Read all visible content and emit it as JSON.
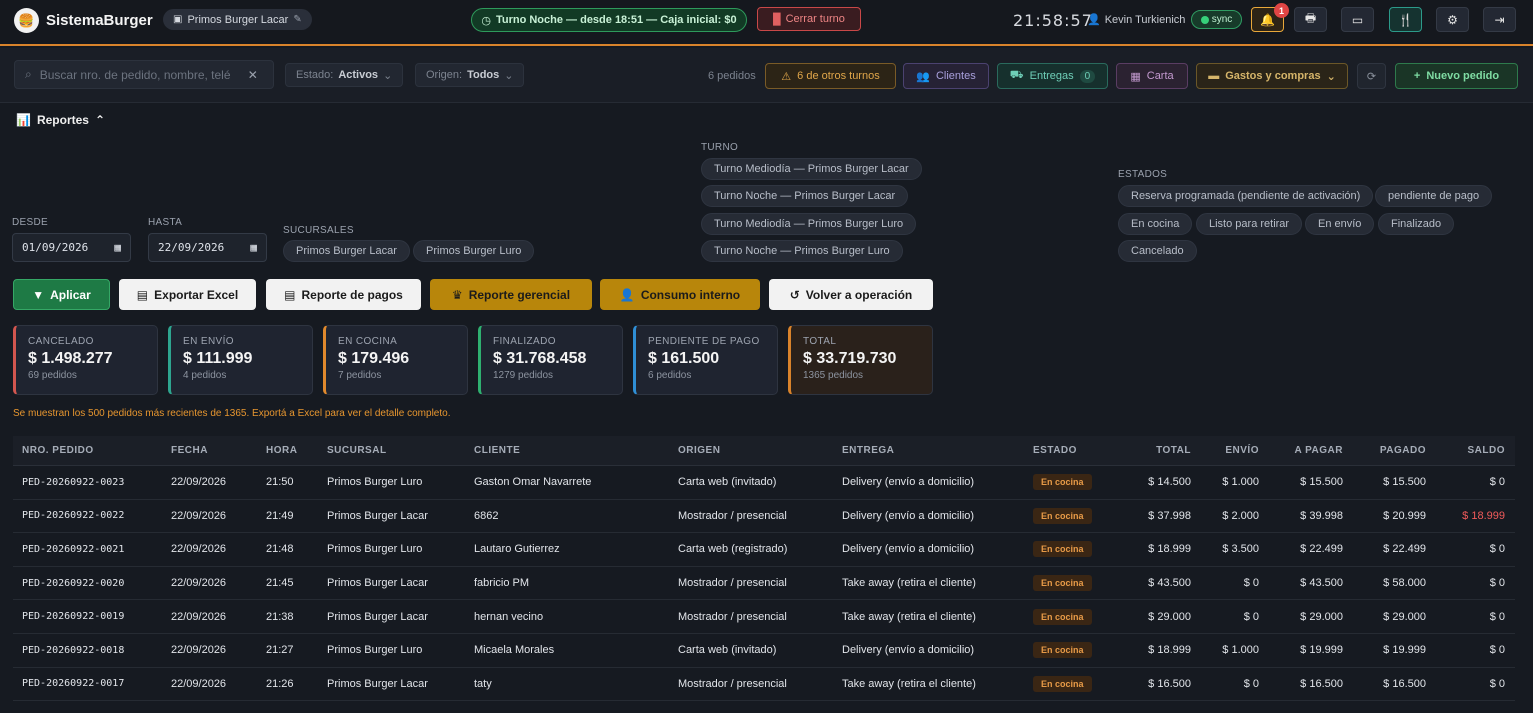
{
  "header": {
    "brand": "SistemaBurger",
    "branch": "Primos Burger Lacar",
    "shift": "Turno Noche — desde 18:51 — Caja inicial: $0",
    "close_shift": "Cerrar turno",
    "clock": "21:58:57",
    "user": "Kevin Turkienich",
    "sync": "sync",
    "notif_count": "1"
  },
  "filters": {
    "search_placeholder": "Buscar nro. de pedido, nombre, telé",
    "estado_label": "Estado:",
    "estado_value": "Activos",
    "origen_label": "Origen:",
    "origen_value": "Todos",
    "count": "6 pedidos",
    "otros_turnos": "6 de otros turnos",
    "clientes": "Clientes",
    "entregas": "Entregas",
    "entregas_count": "0",
    "carta": "Carta",
    "gastos": "Gastos y compras",
    "nuevo": "Nuevo pedido"
  },
  "reports": {
    "title": "Reportes",
    "desde_label": "DESDE",
    "desde": "01/09/2026",
    "hasta_label": "HASTA",
    "hasta": "22/09/2026",
    "sucursales_label": "SUCURSALES",
    "sucursales": [
      "Primos Burger Lacar",
      "Primos Burger Luro"
    ],
    "turno_label": "TURNO",
    "turnos": [
      "Turno Mediodía — Primos Burger Lacar",
      "Turno Noche — Primos Burger Lacar",
      "Turno Mediodía — Primos Burger Luro",
      "Turno Noche — Primos Burger Luro"
    ],
    "estados_label": "ESTADOS",
    "estados": [
      "Reserva programada (pendiente de activación)",
      "pendiente de pago",
      "En cocina",
      "Listo para retirar",
      "En envío",
      "Finalizado",
      "Cancelado"
    ],
    "buttons": {
      "aplicar": "Aplicar",
      "excel": "Exportar Excel",
      "pagos": "Reporte de pagos",
      "gerencial": "Reporte gerencial",
      "consumo": "Consumo interno",
      "volver": "Volver a operación"
    },
    "cards": [
      {
        "k": "CANCELADO",
        "v": "$ 1.498.277",
        "n": "69 pedidos",
        "color": "#d2564f"
      },
      {
        "k": "EN ENVÍO",
        "v": "$ 111.999",
        "n": "4 pedidos",
        "color": "#2ea58f"
      },
      {
        "k": "EN COCINA",
        "v": "$ 179.496",
        "n": "7 pedidos",
        "color": "#e0892d"
      },
      {
        "k": "FINALIZADO",
        "v": "$ 31.768.458",
        "n": "1279 pedidos",
        "color": "#2fb070"
      },
      {
        "k": "PENDIENTE DE PAGO",
        "v": "$ 161.500",
        "n": "6 pedidos",
        "color": "#2f8fd6"
      },
      {
        "k": "TOTAL",
        "v": "$ 33.719.730",
        "n": "1365 pedidos",
        "color": "#d9832b"
      }
    ],
    "notice": "Se muestran los 500 pedidos más recientes de 1365. Exportá a Excel para ver el detalle completo."
  },
  "table": {
    "headers": [
      "NRO. PEDIDO",
      "FECHA",
      "HORA",
      "SUCURSAL",
      "CLIENTE",
      "ORIGEN",
      "ENTREGA",
      "ESTADO",
      "TOTAL",
      "ENVÍO",
      "A PAGAR",
      "PAGADO",
      "SALDO"
    ],
    "rows": [
      [
        "PED-20260922-0023",
        "22/09/2026",
        "21:50",
        "Primos Burger Luro",
        "Gaston Omar Navarrete",
        "Carta web (invitado)",
        "Delivery (envío a domicilio)",
        "En cocina",
        "$ 14.500",
        "$ 1.000",
        "$ 15.500",
        "$ 15.500",
        "$ 0"
      ],
      [
        "PED-20260922-0022",
        "22/09/2026",
        "21:49",
        "Primos Burger Lacar",
        "6862",
        "Mostrador / presencial",
        "Delivery (envío a domicilio)",
        "En cocina",
        "$ 37.998",
        "$ 2.000",
        "$ 39.998",
        "$ 20.999",
        "$ 18.999"
      ],
      [
        "PED-20260922-0021",
        "22/09/2026",
        "21:48",
        "Primos Burger Luro",
        "Lautaro Gutierrez",
        "Carta web (registrado)",
        "Delivery (envío a domicilio)",
        "En cocina",
        "$ 18.999",
        "$ 3.500",
        "$ 22.499",
        "$ 22.499",
        "$ 0"
      ],
      [
        "PED-20260922-0020",
        "22/09/2026",
        "21:45",
        "Primos Burger Lacar",
        "fabricio PM",
        "Mostrador / presencial",
        "Take away (retira el cliente)",
        "En cocina",
        "$ 43.500",
        "$ 0",
        "$ 43.500",
        "$ 58.000",
        "$ 0"
      ],
      [
        "PED-20260922-0019",
        "22/09/2026",
        "21:38",
        "Primos Burger Lacar",
        "hernan vecino",
        "Mostrador / presencial",
        "Take away (retira el cliente)",
        "En cocina",
        "$ 29.000",
        "$ 0",
        "$ 29.000",
        "$ 29.000",
        "$ 0"
      ],
      [
        "PED-20260922-0018",
        "22/09/2026",
        "21:27",
        "Primos Burger Luro",
        "Micaela Morales",
        "Carta web (invitado)",
        "Delivery (envío a domicilio)",
        "En cocina",
        "$ 18.999",
        "$ 1.000",
        "$ 19.999",
        "$ 19.999",
        "$ 0"
      ],
      [
        "PED-20260922-0017",
        "22/09/2026",
        "21:26",
        "Primos Burger Lacar",
        "taty",
        "Mostrador / presencial",
        "Take away (retira el cliente)",
        "En cocina",
        "$ 16.500",
        "$ 0",
        "$ 16.500",
        "$ 16.500",
        "$ 0"
      ]
    ]
  }
}
